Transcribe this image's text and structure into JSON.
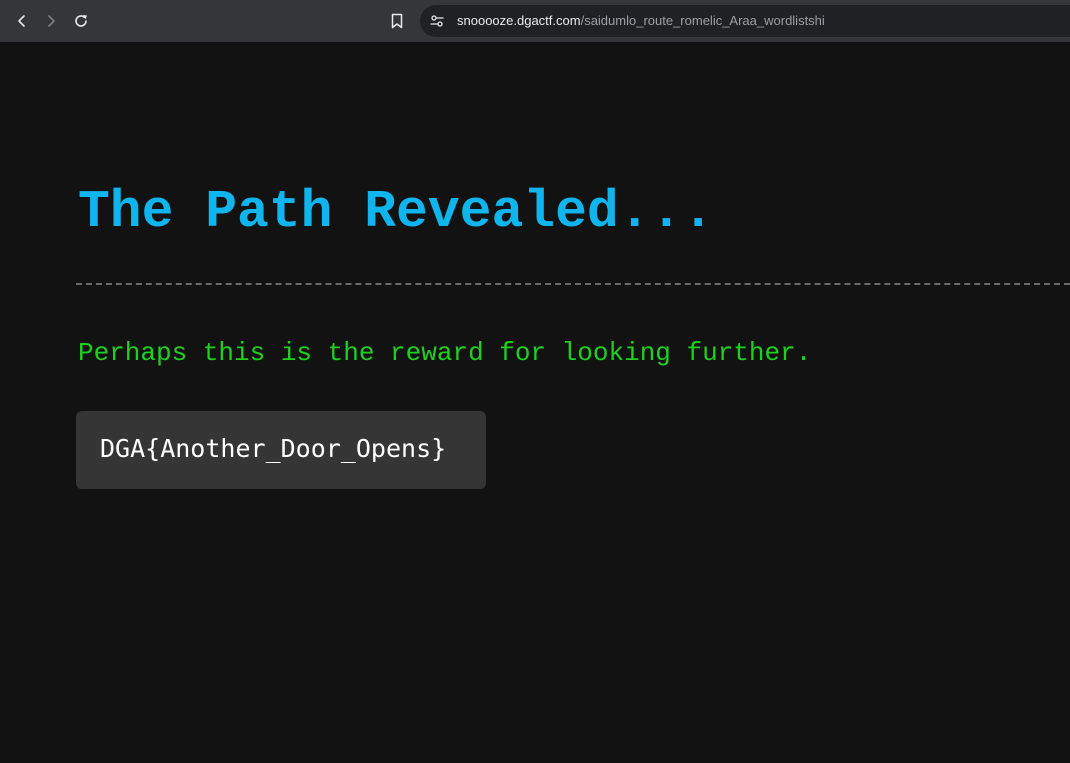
{
  "browser": {
    "icons": {
      "back": "arrow-left-icon",
      "forward": "arrow-right-icon",
      "reload": "reload-icon",
      "bookmark": "bookmark-icon",
      "site_info": "tune-icon"
    },
    "url_host": "snooooze.dgactf.com",
    "url_path": "/saidumlo_route_romelic_Araa_wordlistshi"
  },
  "page": {
    "heading": "The Path Revealed...",
    "message": "Perhaps this is the reward for looking further.",
    "flag": "DGA{Another_Door_Opens}"
  },
  "colors": {
    "heading": "#0fb5ec",
    "message": "#1fd01f",
    "background": "#121212",
    "flag_box": "#353535"
  }
}
